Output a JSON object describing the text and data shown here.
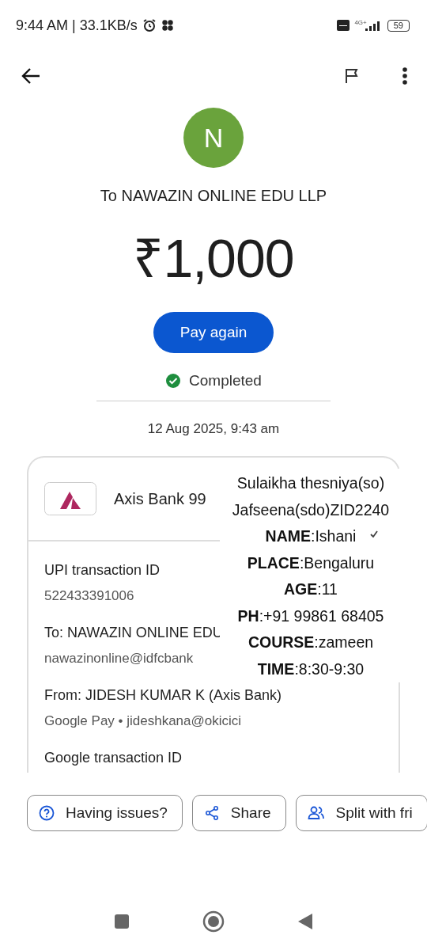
{
  "status_bar": {
    "time": "9:44 AM | 33.1KB/s",
    "network": "4G+",
    "battery": "59"
  },
  "payee": {
    "initial": "N",
    "title": "To NAWAZIN ONLINE EDU LLP",
    "amount": "₹1,000",
    "button": "Pay again",
    "status": "Completed",
    "date": "12 Aug 2025, 9:43 am"
  },
  "card": {
    "bank": "Axis Bank 99",
    "details": [
      {
        "label": "UPI transaction ID",
        "value": "522433391006"
      },
      {
        "label": "To: NAWAZIN ONLINE EDU",
        "value": "nawazinonline@idfcbank"
      },
      {
        "label": "From: JIDESH KUMAR K (Axis Bank)",
        "value": "Google Pay • jideshkana@okicici"
      },
      {
        "label": "Google transaction ID"
      }
    ]
  },
  "overlay_note": {
    "lines": [
      "Sulaikha thesniya(so)",
      "Jafseena(sdo)ZID2240",
      "**NAME**:Ishani",
      "**PLACE**:Bengaluru",
      "**AGE**:11",
      "**PH**:+91 99861 68405",
      "**COURSE**:zameen",
      "**TIME**:8:30-9:30"
    ]
  },
  "actions": [
    {
      "kind": "help",
      "label": "Having issues?"
    },
    {
      "kind": "share",
      "label": "Share"
    },
    {
      "kind": "split",
      "label": "Split with fri"
    }
  ]
}
